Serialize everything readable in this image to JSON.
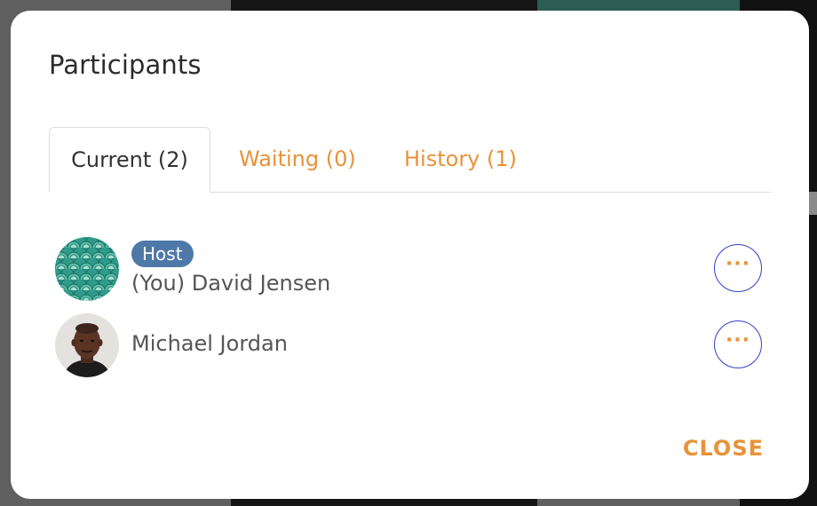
{
  "dialog": {
    "title": "Participants",
    "tabs": [
      {
        "label": "Current (2)",
        "active": true
      },
      {
        "label": "Waiting (0)",
        "active": false
      },
      {
        "label": "History (1)",
        "active": false
      }
    ],
    "participants": [
      {
        "badge": "Host",
        "name": "(You) David Jensen",
        "avatar": "teal-pattern-avatar",
        "more_label": "···"
      },
      {
        "name": "Michael Jordan",
        "avatar": "portrait-avatar",
        "more_label": "···"
      }
    ],
    "close_label": "CLOSE"
  },
  "colors": {
    "accent": "#e8923a",
    "badge": "#4e78a8",
    "more_border": "#3340c8"
  }
}
